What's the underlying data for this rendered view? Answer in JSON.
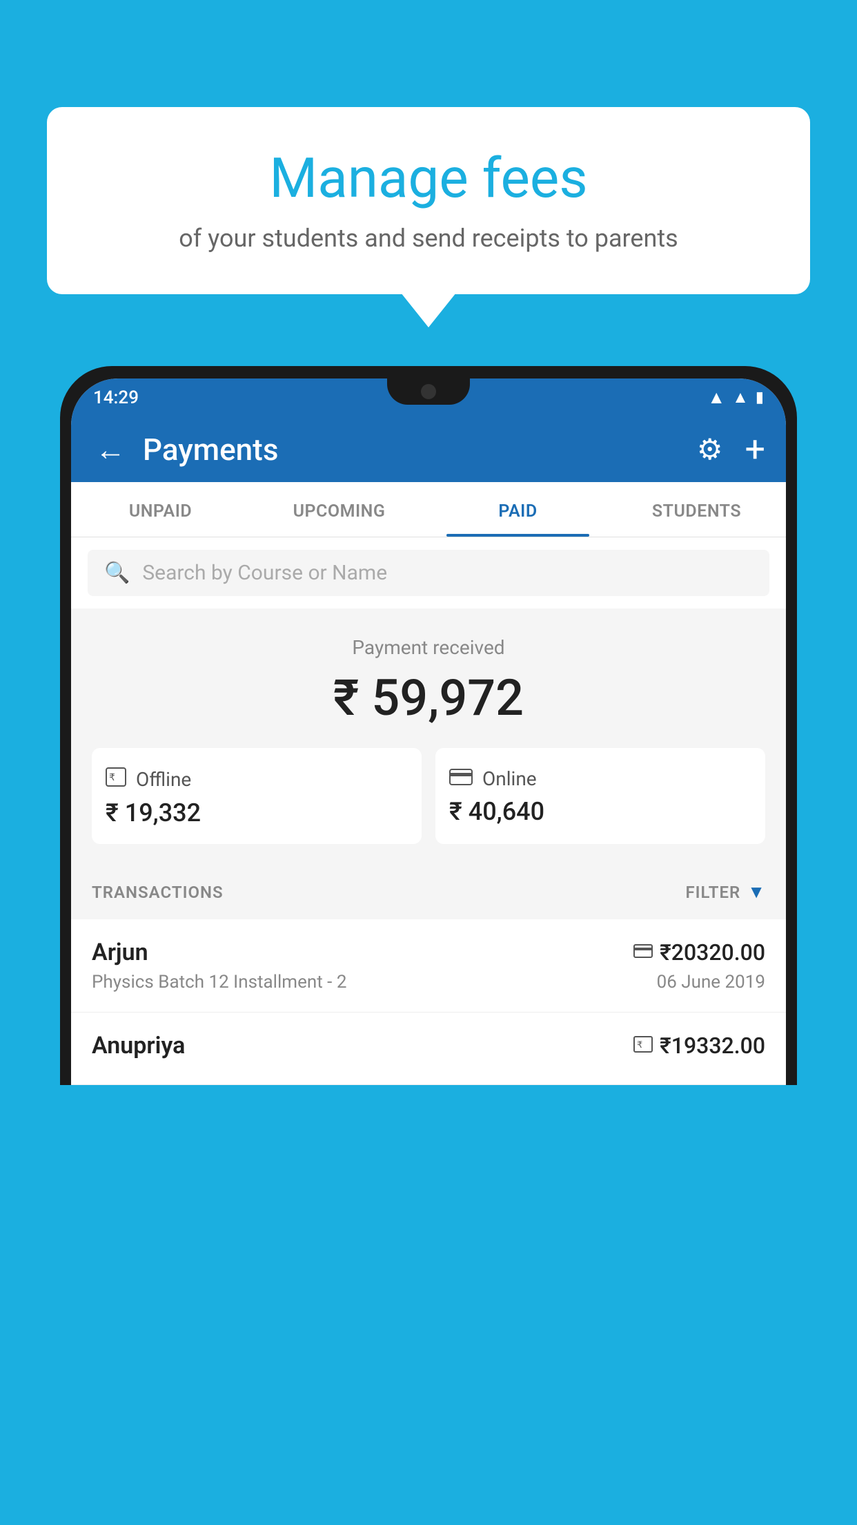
{
  "background_color": "#1BAFE0",
  "bubble": {
    "title": "Manage fees",
    "subtitle": "of your students and send receipts to parents"
  },
  "status_bar": {
    "time": "14:29",
    "wifi_icon": "wifi",
    "signal_icon": "signal",
    "battery_icon": "battery"
  },
  "header": {
    "title": "Payments",
    "back_label": "←",
    "gear_label": "⚙",
    "plus_label": "+"
  },
  "tabs": [
    {
      "label": "UNPAID",
      "active": false
    },
    {
      "label": "UPCOMING",
      "active": false
    },
    {
      "label": "PAID",
      "active": true
    },
    {
      "label": "STUDENTS",
      "active": false
    }
  ],
  "search": {
    "placeholder": "Search by Course or Name"
  },
  "payment_summary": {
    "label": "Payment received",
    "amount": "₹ 59,972",
    "offline": {
      "icon": "💳",
      "label": "Offline",
      "amount": "₹ 19,332"
    },
    "online": {
      "icon": "💳",
      "label": "Online",
      "amount": "₹ 40,640"
    }
  },
  "transactions": {
    "label": "TRANSACTIONS",
    "filter_label": "FILTER",
    "items": [
      {
        "name": "Arjun",
        "amount": "₹20320.00",
        "amount_icon": "card",
        "course": "Physics Batch 12 Installment - 2",
        "date": "06 June 2019"
      },
      {
        "name": "Anupriya",
        "amount": "₹19332.00",
        "amount_icon": "cash",
        "course": "",
        "date": ""
      }
    ]
  }
}
